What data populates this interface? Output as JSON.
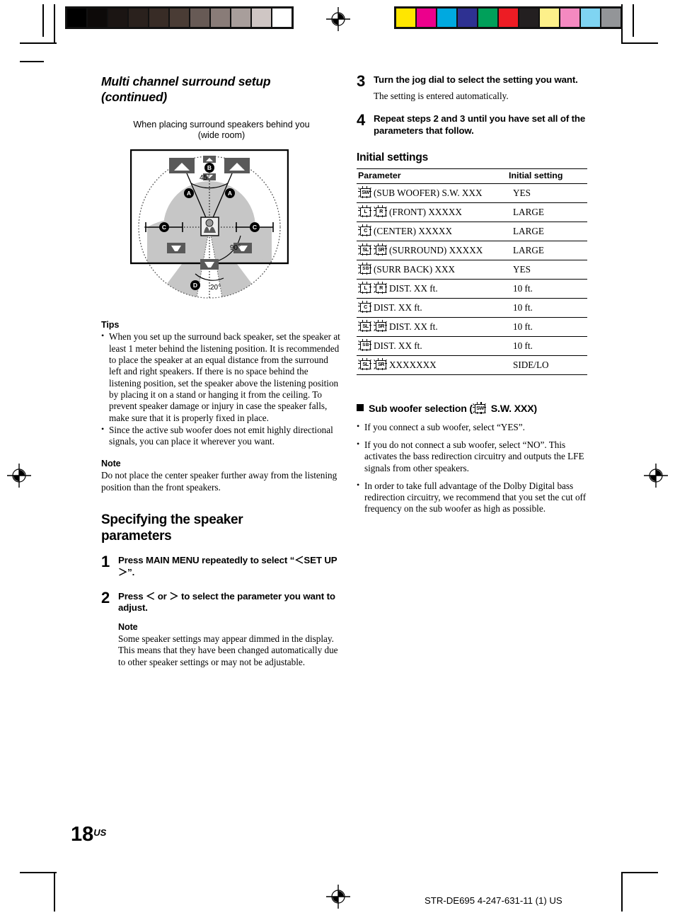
{
  "print_marks": {
    "grayscale_bar": [
      "#000000",
      "#0d0a09",
      "#1b1513",
      "#2a211d",
      "#382c26",
      "#4a3c35",
      "#675a55",
      "#897c78",
      "#a89e9b",
      "#cfc6c4",
      "#ffffff"
    ],
    "color_bar": [
      "#ffe600",
      "#ec008c",
      "#00a9e0",
      "#2e3192",
      "#00a05a",
      "#ed1c24",
      "#231f20",
      "#fdf08a",
      "#f489c0",
      "#7fd4f2",
      "#939598"
    ],
    "registration_icon": "registration-target-icon"
  },
  "left_column": {
    "chapter_title_line1": "Multi channel surround setup",
    "chapter_title_line2": "(continued)",
    "figure": {
      "caption_line1": "When placing surround speakers behind you",
      "caption_line2": "(wide room)",
      "angle_front": "45°",
      "angle_side": "90°",
      "angle_rear": "20°",
      "callout_a": "A",
      "callout_b": "B",
      "callout_c": "C",
      "callout_d": "D"
    },
    "tips_heading": "Tips",
    "tips": [
      "When you set up the surround back speaker, set the speaker at least 1 meter behind the listening position. It is recommended to place the speaker at an equal distance from the surround left and right speakers. If there is no space behind the listening position, set the speaker above the listening position by placing it on a stand or hanging it from the ceiling. To prevent speaker damage or injury in case the speaker falls, make sure that it is properly fixed in place.",
      "Since the active sub woofer does not emit highly directional signals, you can place it wherever you want."
    ],
    "note_heading": "Note",
    "note_text": "Do not place the center speaker further away from the listening position than the front speakers.",
    "section_heading_line1": "Specifying the speaker",
    "section_heading_line2": "parameters",
    "steps": [
      {
        "num": "1",
        "text": "Press MAIN MENU repeatedly to select “＜SET UP＞”."
      },
      {
        "num": "2",
        "text": "Press ＜ or ＞ to select the parameter you want to adjust.",
        "note_heading": "Note",
        "note_text": "Some speaker settings may appear dimmed in the display. This means that they have been changed automatically due to other speaker settings or may not be adjustable."
      }
    ]
  },
  "right_column": {
    "steps": [
      {
        "num": "3",
        "text": "Turn the jog dial to select the setting you want.",
        "body": "The setting is entered automatically."
      },
      {
        "num": "4",
        "text": "Repeat steps 2 and 3 until you have set all of the parameters that follow."
      }
    ],
    "table_heading": "Initial settings",
    "table": {
      "headers": [
        "Parameter",
        "Initial setting"
      ],
      "rows": [
        {
          "icons": [
            "SW"
          ],
          "param": "(SUB WOOFER) S.W. XXX",
          "value": "YES"
        },
        {
          "icons": [
            "L",
            "R"
          ],
          "param": "(FRONT) XXXXX",
          "value": "LARGE"
        },
        {
          "icons": [
            "C"
          ],
          "param": "(CENTER) XXXXX",
          "value": "LARGE"
        },
        {
          "icons": [
            "SL",
            "SR"
          ],
          "param": "(SURROUND) XXXXX",
          "value": "LARGE"
        },
        {
          "icons": [
            "S B"
          ],
          "param": "(SURR BACK) XXX",
          "value": "YES"
        },
        {
          "icons": [
            "L",
            "R"
          ],
          "param": "DIST. XX ft.",
          "value": "10 ft."
        },
        {
          "icons": [
            "C"
          ],
          "param": "DIST. XX ft.",
          "value": "10 ft."
        },
        {
          "icons": [
            "SL",
            "SR"
          ],
          "param": "DIST. XX ft.",
          "value": "10 ft."
        },
        {
          "icons": [
            "S B"
          ],
          "param": "DIST. XX ft.",
          "value": "10 ft."
        },
        {
          "icons": [
            "SL",
            "SR"
          ],
          "param": "XXXXXXX",
          "value": "SIDE/LO"
        }
      ]
    },
    "subwoofer_section": {
      "heading_before_icon": "Sub woofer selection (",
      "heading_icon": "SW",
      "heading_after_icon": " S.W. XXX)",
      "bullets": [
        "If you connect a sub woofer, select “YES”.",
        "If you do not connect a sub woofer, select “NO”. This activates the bass redirection circuitry and outputs the LFE signals from other speakers.",
        "In order to take full advantage of the Dolby Digital bass redirection circuitry, we recommend that you set the cut off frequency on the sub woofer as high as possible."
      ]
    }
  },
  "page_number": "18",
  "page_number_suffix": "US",
  "footer": "STR-DE695 4-247-631-11 (1) US"
}
